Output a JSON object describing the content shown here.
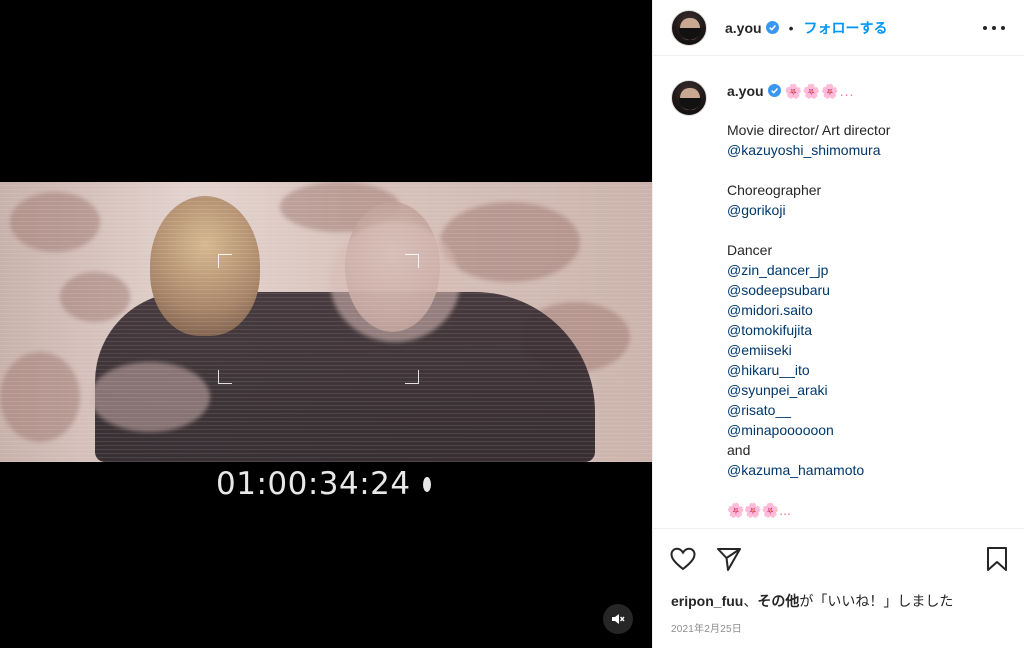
{
  "video": {
    "timecode": "01:00:34:24",
    "mute_icon": "speaker-muted-icon"
  },
  "header": {
    "username": "a.you",
    "separator": "•",
    "follow_label": "フォローする",
    "more_icon": "more-options-icon"
  },
  "caption": {
    "username": "a.you",
    "title_emoji": "🌸🌸🌸...",
    "lines": [
      {
        "text": "Movie director/ Art director",
        "type": "text"
      },
      {
        "text": "@kazuyoshi_shimomura",
        "type": "mention"
      },
      {
        "text": "",
        "type": "blank"
      },
      {
        "text": "Choreographer",
        "type": "text"
      },
      {
        "text": "@gorikoji",
        "type": "mention"
      },
      {
        "text": "",
        "type": "blank"
      },
      {
        "text": "Dancer",
        "type": "text"
      },
      {
        "text": "@zin_dancer_jp",
        "type": "mention"
      },
      {
        "text": "@sodeepsubaru",
        "type": "mention"
      },
      {
        "text": "@midori.saito",
        "type": "mention"
      },
      {
        "text": "@tomokifujita",
        "type": "mention"
      },
      {
        "text": "@emiiseki",
        "type": "mention"
      },
      {
        "text": "@hikaru__ito",
        "type": "mention"
      },
      {
        "text": "@syunpei_araki",
        "type": "mention"
      },
      {
        "text": "@risato__",
        "type": "mention"
      },
      {
        "text": "@minapoooooon",
        "type": "mention"
      },
      {
        "text": "and",
        "type": "text"
      },
      {
        "text": "@kazuma_hamamoto",
        "type": "mention"
      },
      {
        "text": "",
        "type": "blank"
      },
      {
        "text": "🌸🌸🌸...",
        "type": "emoji"
      }
    ]
  },
  "actions": {
    "like_icon": "heart-icon",
    "share_icon": "paper-plane-icon",
    "save_icon": "bookmark-icon"
  },
  "likes": {
    "user": "eripon_fuu",
    "sep": "、",
    "others": "その他",
    "suffix": "が「いいね！」しました"
  },
  "date": "2021年2月25日",
  "colors": {
    "accent": "#0095f6",
    "mention": "#00376b",
    "verified": "#3897f0"
  }
}
